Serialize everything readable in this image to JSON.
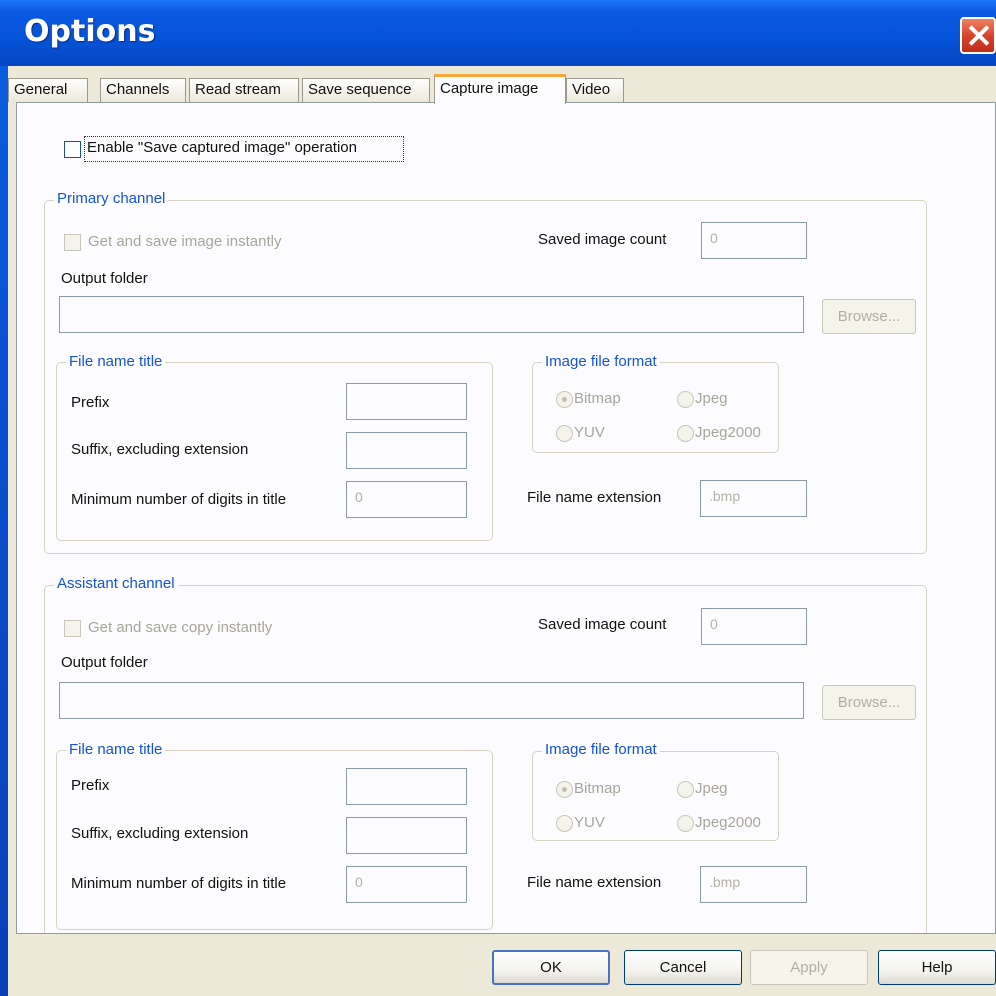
{
  "window": {
    "title": "Options"
  },
  "tabs": [
    {
      "label": "General"
    },
    {
      "label": "Channels"
    },
    {
      "label": "Read stream"
    },
    {
      "label": "Save sequence"
    },
    {
      "label": "Capture image",
      "active": true
    },
    {
      "label": "Video"
    }
  ],
  "enable_checkbox": {
    "label": "Enable \"Save captured image\" operation",
    "checked": false
  },
  "primary": {
    "title": "Primary channel",
    "instant_label": "Get and save image instantly",
    "saved_count_label": "Saved image count",
    "saved_count_value": "0",
    "output_folder_label": "Output folder",
    "output_folder_value": "",
    "browse_label": "Browse...",
    "filename_group_title": "File name title",
    "prefix_label": "Prefix",
    "prefix_value": "",
    "suffix_label": "Suffix, excluding extension",
    "suffix_value": "",
    "min_digits_label": "Minimum number of digits in title",
    "min_digits_value": "0",
    "format_group_title": "Image file format",
    "formats": [
      "Bitmap",
      "Jpeg",
      "YUV",
      "Jpeg2000"
    ],
    "selected_format": "Bitmap",
    "ext_label": "File name extension",
    "ext_value": ".bmp"
  },
  "assistant": {
    "title": "Assistant channel",
    "instant_label": "Get and save copy instantly",
    "saved_count_label": "Saved image count",
    "saved_count_value": "0",
    "output_folder_label": "Output folder",
    "output_folder_value": "",
    "browse_label": "Browse...",
    "filename_group_title": "File name title",
    "prefix_label": "Prefix",
    "prefix_value": "",
    "suffix_label": "Suffix, excluding extension",
    "suffix_value": "",
    "min_digits_label": "Minimum number of digits in title",
    "min_digits_value": "0",
    "format_group_title": "Image file format",
    "formats": [
      "Bitmap",
      "Jpeg",
      "YUV",
      "Jpeg2000"
    ],
    "selected_format": "Bitmap",
    "ext_label": "File name extension",
    "ext_value": ".bmp"
  },
  "footer": {
    "ok": "OK",
    "cancel": "Cancel",
    "apply": "Apply",
    "help": "Help"
  },
  "colors": {
    "title_bar": "#0a58e2",
    "accent_tab": "#f8a838",
    "group_title": "#1552d8",
    "close_button": "#d5402a"
  }
}
